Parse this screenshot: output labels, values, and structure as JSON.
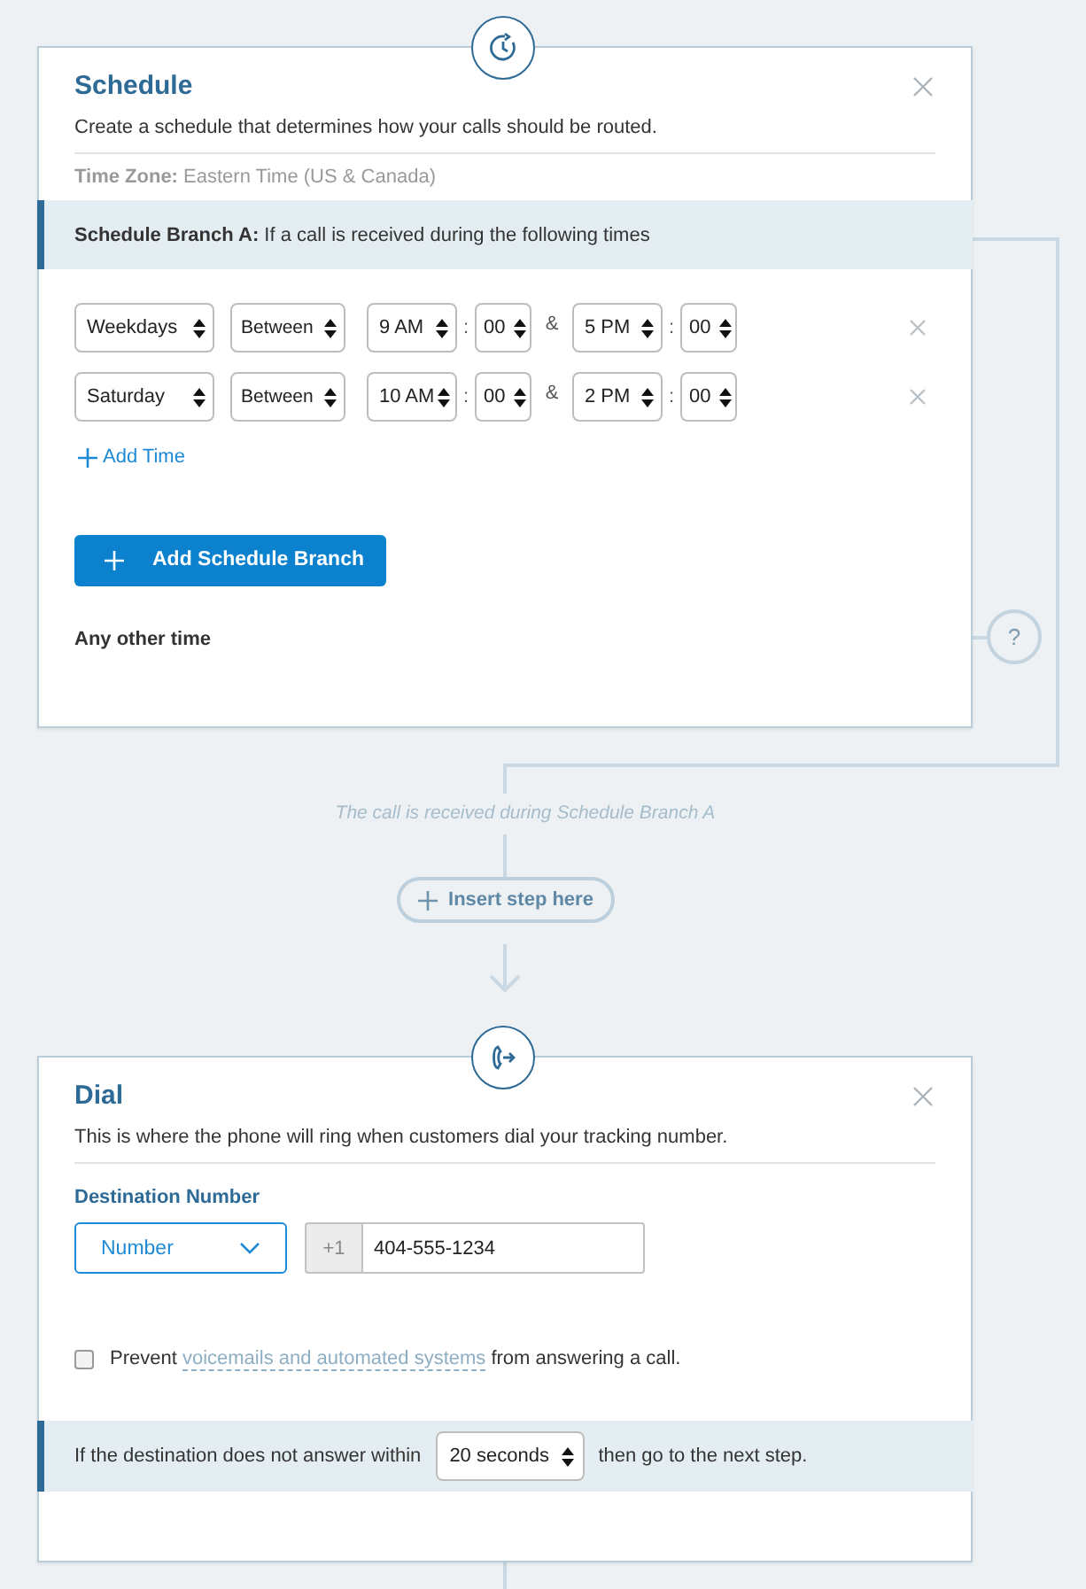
{
  "schedule": {
    "title": "Schedule",
    "description": "Create a schedule that determines how your calls should be routed.",
    "time_zone_label": "Time Zone:",
    "time_zone_value": "Eastern Time (US & Canada)",
    "branch": {
      "label": "Schedule Branch A:",
      "text": "If a call is received during the following times"
    },
    "time_rows": [
      {
        "day": "Weekdays",
        "mode": "Between",
        "start_hour": "9 AM",
        "start_sep": ":",
        "start_minute": "00",
        "joiner": "&",
        "end_hour": "5 PM",
        "end_sep": ":",
        "end_minute": "00"
      },
      {
        "day": "Saturday",
        "mode": "Between",
        "start_hour": "10 AM",
        "start_sep": ":",
        "start_minute": "00",
        "joiner": "&",
        "end_hour": "2 PM",
        "end_sep": ":",
        "end_minute": "00"
      }
    ],
    "add_time": "Add Time",
    "add_branch_button": "Add Schedule Branch",
    "other_time": "Any other time",
    "other_time_marker": "?"
  },
  "connector_label": "The call is received during Schedule Branch A",
  "insert_step_button": "Insert step here",
  "dial": {
    "title": "Dial",
    "description": "This is where the phone will ring when customers dial your tracking number.",
    "destination_label": "Destination Number",
    "destination_type": "Number",
    "country_code": "+1",
    "phone": "404-555-1234",
    "prevent": {
      "checked": false,
      "before": "Prevent",
      "link": "voicemails and automated systems",
      "after": "from answering a call."
    },
    "timeout": {
      "before": "If the destination does not answer within",
      "value": "20 seconds",
      "after": "then go to the next step."
    }
  }
}
